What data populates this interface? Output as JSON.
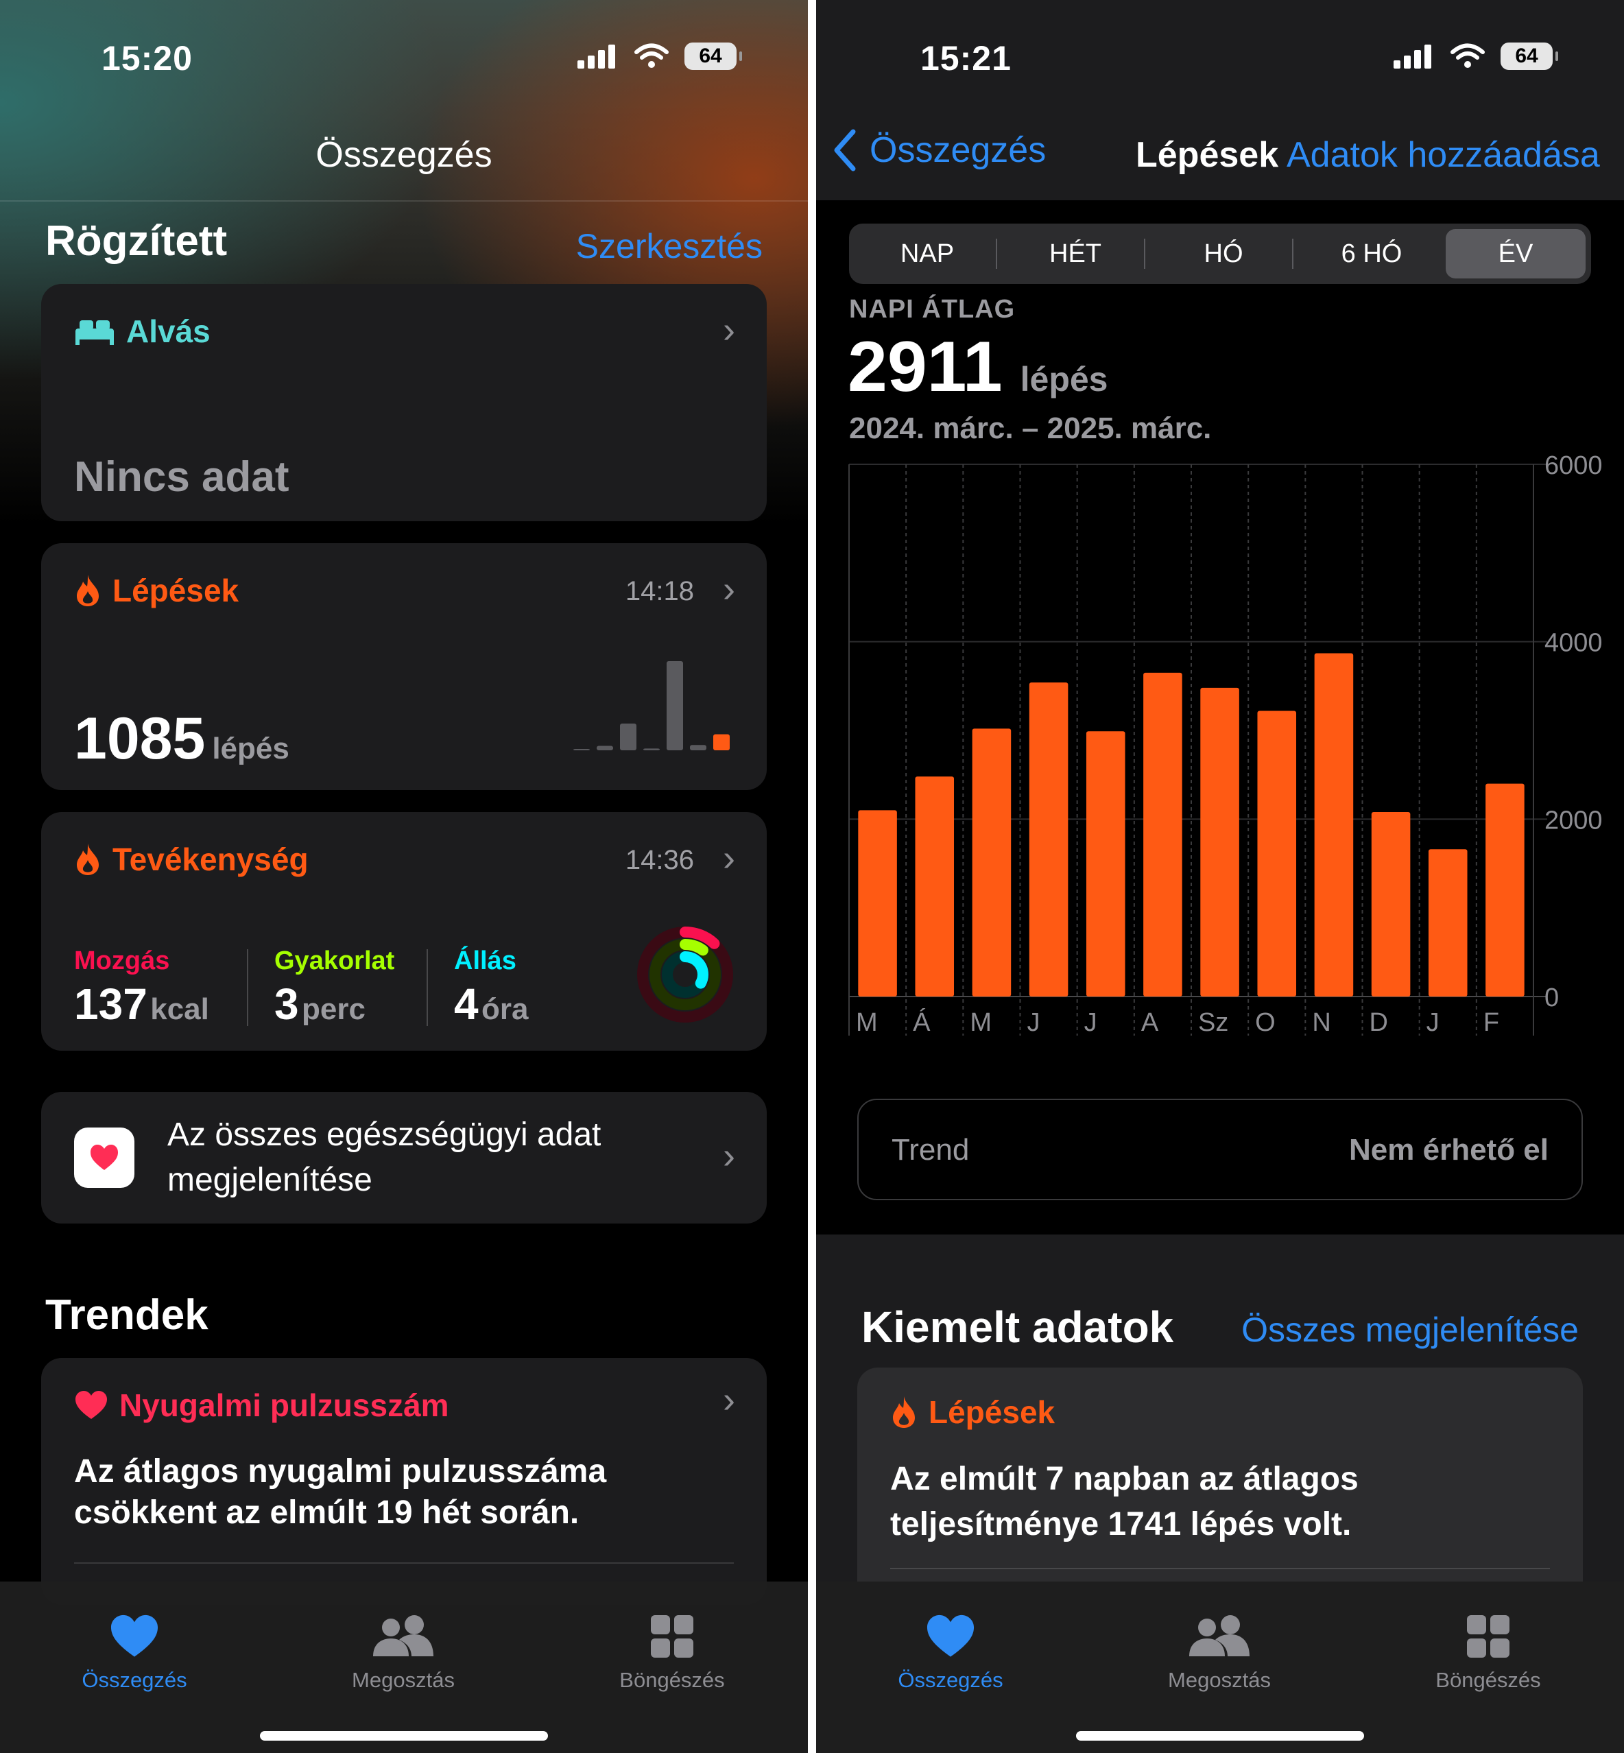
{
  "left": {
    "status": {
      "time": "15:20",
      "battery": "64"
    },
    "nav_title": "Összegzés",
    "pinned": {
      "title": "Rögzített",
      "edit": "Szerkesztés",
      "sleep": {
        "label": "Alvás",
        "value": "Nincs adat"
      },
      "steps": {
        "label": "Lépések",
        "time": "14:18",
        "value": "1085",
        "unit": "lépés",
        "mini_bars": [
          0.01,
          0.05,
          0.3,
          0.02,
          1.0,
          0.06,
          0.18
        ]
      },
      "activity": {
        "label": "Tevékenység",
        "time": "14:36",
        "move": {
          "label": "Mozgás",
          "value": "137",
          "unit": "kcal"
        },
        "exercise": {
          "label": "Gyakorlat",
          "value": "3",
          "unit": "perc"
        },
        "stand": {
          "label": "Állás",
          "value": "4",
          "unit": "óra"
        },
        "rings": {
          "move": 0.12,
          "exercise": 0.1,
          "stand": 0.33
        }
      },
      "all_data": "Az összes egészségügyi adat megjelenítése"
    },
    "trends": {
      "title": "Trendek",
      "item": {
        "label": "Nyugalmi pulzusszám",
        "text": "Az átlagos nyugalmi pulzusszáma csökkent az elmúlt 19 hét során."
      }
    },
    "tabs": [
      "Összegzés",
      "Megosztás",
      "Böngészés"
    ]
  },
  "right": {
    "status": {
      "time": "15:21",
      "battery": "64"
    },
    "back": "Összegzés",
    "title": "Lépések",
    "add_data": "Adatok hozzáadása",
    "segments": [
      "NAP",
      "HÉT",
      "HÓ",
      "6 HÓ",
      "ÉV"
    ],
    "summary": {
      "label": "NAPI ÁTLAG",
      "value": "2911",
      "unit": "lépés",
      "range": "2024. márc. – 2025. márc."
    },
    "trend": {
      "label": "Trend",
      "value": "Nem érhető el"
    },
    "highlights": {
      "title": "Kiemelt adatok",
      "show_all": "Összes megjelenítése",
      "item": {
        "label": "Lépések",
        "text": "Az elmúlt 7 napban az átlagos teljesítménye 1741 lépés volt."
      }
    },
    "tabs": [
      "Összegzés",
      "Megosztás",
      "Böngészés"
    ]
  },
  "colors": {
    "accent": "#ff5a14",
    "link": "#2f8cf5",
    "teal": "#5ad9d6",
    "pink": "#ff2d55",
    "move": "#fa114f",
    "exercise": "#a6ff00",
    "stand": "#00f0ff"
  },
  "chart_data": {
    "type": "bar",
    "categories": [
      "M",
      "Á",
      "M",
      "J",
      "J",
      "A",
      "Sz",
      "O",
      "N",
      "D",
      "J",
      "F"
    ],
    "values": [
      2100,
      2480,
      3020,
      3540,
      2990,
      3650,
      3480,
      3220,
      3870,
      2080,
      1660,
      2400
    ],
    "ylim": [
      0,
      6000
    ],
    "yticks": [
      "6000",
      "4000",
      "2000",
      "0"
    ],
    "color": "#ff5a14"
  }
}
